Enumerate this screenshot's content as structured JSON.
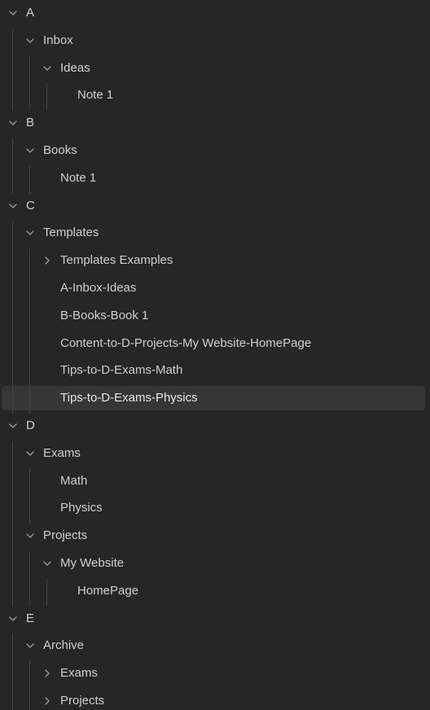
{
  "tree": {
    "items": [
      {
        "label": "A",
        "depth": 0,
        "expanded": true,
        "has_children": true,
        "chevron_icon": "chevron-down-icon"
      },
      {
        "label": "Inbox",
        "depth": 1,
        "expanded": true,
        "has_children": true,
        "chevron_icon": "chevron-down-icon"
      },
      {
        "label": "Ideas",
        "depth": 2,
        "expanded": true,
        "has_children": true,
        "chevron_icon": "chevron-down-icon"
      },
      {
        "label": "Note 1",
        "depth": 3,
        "expanded": false,
        "has_children": false
      },
      {
        "label": "B",
        "depth": 0,
        "expanded": true,
        "has_children": true,
        "chevron_icon": "chevron-down-icon"
      },
      {
        "label": "Books",
        "depth": 1,
        "expanded": true,
        "has_children": true,
        "chevron_icon": "chevron-down-icon"
      },
      {
        "label": "Note 1",
        "depth": 2,
        "expanded": false,
        "has_children": false
      },
      {
        "label": "C",
        "depth": 0,
        "expanded": true,
        "has_children": true,
        "chevron_icon": "chevron-down-icon"
      },
      {
        "label": "Templates",
        "depth": 1,
        "expanded": true,
        "has_children": true,
        "chevron_icon": "chevron-down-icon"
      },
      {
        "label": "Templates Examples",
        "depth": 2,
        "expanded": false,
        "has_children": true,
        "chevron_icon": "chevron-right-icon"
      },
      {
        "label": "A-Inbox-Ideas",
        "depth": 2,
        "expanded": false,
        "has_children": false
      },
      {
        "label": "B-Books-Book 1",
        "depth": 2,
        "expanded": false,
        "has_children": false
      },
      {
        "label": "Content-to-D-Projects-My Website-HomePage",
        "depth": 2,
        "expanded": false,
        "has_children": false
      },
      {
        "label": "Tips-to-D-Exams-Math",
        "depth": 2,
        "expanded": false,
        "has_children": false
      },
      {
        "label": "Tips-to-D-Exams-Physics",
        "depth": 2,
        "expanded": false,
        "has_children": false,
        "selected": true
      },
      {
        "label": "D",
        "depth": 0,
        "expanded": true,
        "has_children": true,
        "chevron_icon": "chevron-down-icon"
      },
      {
        "label": "Exams",
        "depth": 1,
        "expanded": true,
        "has_children": true,
        "chevron_icon": "chevron-down-icon"
      },
      {
        "label": "Math",
        "depth": 2,
        "expanded": false,
        "has_children": false
      },
      {
        "label": "Physics",
        "depth": 2,
        "expanded": false,
        "has_children": false
      },
      {
        "label": "Projects",
        "depth": 1,
        "expanded": true,
        "has_children": true,
        "chevron_icon": "chevron-down-icon"
      },
      {
        "label": "My Website",
        "depth": 2,
        "expanded": true,
        "has_children": true,
        "chevron_icon": "chevron-down-icon"
      },
      {
        "label": "HomePage",
        "depth": 3,
        "expanded": false,
        "has_children": false
      },
      {
        "label": "E",
        "depth": 0,
        "expanded": true,
        "has_children": true,
        "chevron_icon": "chevron-down-icon"
      },
      {
        "label": "Archive",
        "depth": 1,
        "expanded": true,
        "has_children": true,
        "chevron_icon": "chevron-down-icon"
      },
      {
        "label": "Exams",
        "depth": 2,
        "expanded": false,
        "has_children": true,
        "chevron_icon": "chevron-right-icon"
      },
      {
        "label": "Projects",
        "depth": 2,
        "expanded": false,
        "has_children": true,
        "chevron_icon": "chevron-right-icon"
      }
    ]
  },
  "colors": {
    "background": "#262626",
    "selected_row": "#363636",
    "text": "#cfcfcf",
    "chevron": "#9a9a9a",
    "guide_line": "#444444"
  }
}
